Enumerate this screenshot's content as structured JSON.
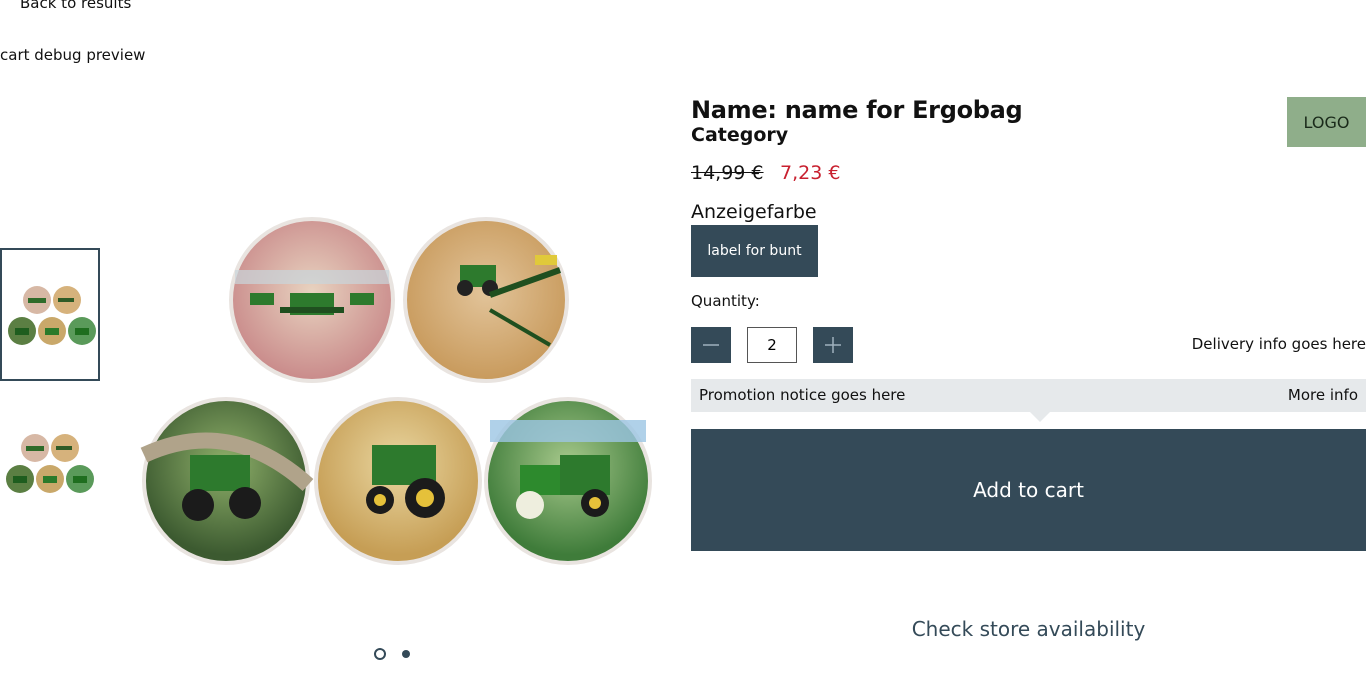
{
  "nav": {
    "back_label": "Back to results",
    "debug_label": "cart debug preview"
  },
  "gallery": {
    "thumbnails": [
      {
        "name": "thumbnail-1",
        "active": true
      },
      {
        "name": "thumbnail-2",
        "active": false
      }
    ],
    "slides": 2,
    "active_slide": 1
  },
  "product": {
    "title": "Name: name for Ergobag",
    "category": "Category",
    "logo": "LOGO",
    "old_price": "14,99 €",
    "new_price": "7,23 €",
    "color_label": "Anzeigefarbe",
    "color_option": "label for bunt",
    "quantity_label": "Quantity:",
    "quantity": "2",
    "delivery": "Delivery info goes here",
    "promo_text": "Promotion notice goes here",
    "promo_more": "More info",
    "add_to_cart": "Add to cart",
    "store": "Check store availability"
  },
  "colors": {
    "primary": "#344a58",
    "sale": "#c8202f",
    "logo_bg": "#8fae8a",
    "promo_bg": "#e6e9eb"
  },
  "icons": {
    "minus": "minus-icon",
    "plus": "plus-icon"
  }
}
